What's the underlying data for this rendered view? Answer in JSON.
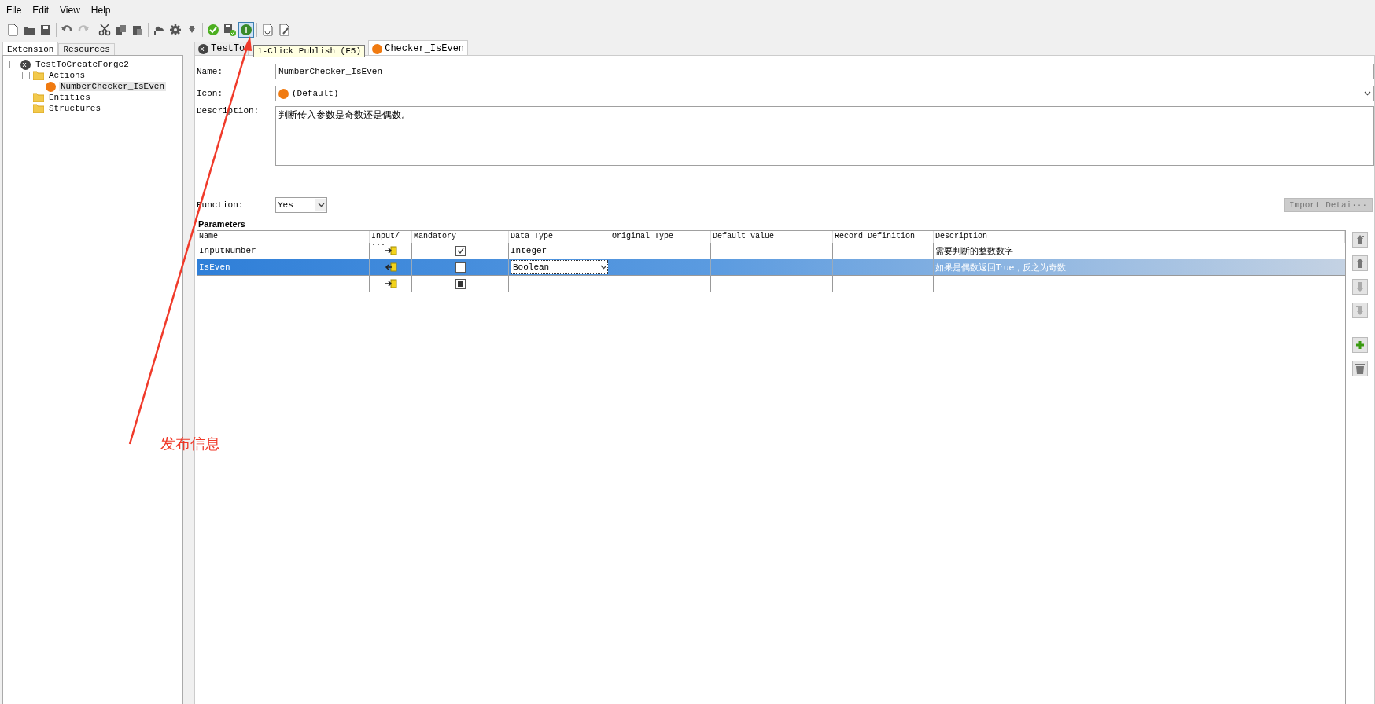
{
  "menu": [
    {
      "label": "File"
    },
    {
      "label": "Edit"
    },
    {
      "label": "View"
    },
    {
      "label": "Help"
    }
  ],
  "toolbar": [
    {
      "kind": "new",
      "highlighted": false
    },
    {
      "kind": "open",
      "highlighted": false
    },
    {
      "kind": "save",
      "highlighted": false
    },
    {
      "kind": "sep"
    },
    {
      "kind": "undo",
      "highlighted": false
    },
    {
      "kind": "redo",
      "highlighted": false
    },
    {
      "kind": "sep"
    },
    {
      "kind": "cut",
      "highlighted": false
    },
    {
      "kind": "copy",
      "highlighted": false
    },
    {
      "kind": "paste",
      "highlighted": false
    },
    {
      "kind": "sep"
    },
    {
      "kind": "deploy",
      "highlighted": false
    },
    {
      "kind": "settings",
      "highlighted": false
    },
    {
      "kind": "download",
      "highlighted": false
    },
    {
      "kind": "sep"
    },
    {
      "kind": "validate",
      "highlighted": false
    },
    {
      "kind": "save-check",
      "highlighted": false
    },
    {
      "kind": "publish",
      "highlighted": true
    },
    {
      "kind": "sep"
    },
    {
      "kind": "code-refresh",
      "highlighted": false
    },
    {
      "kind": "code-edit",
      "highlighted": false
    }
  ],
  "tooltip": "1-Click Publish (F5)",
  "side_tabs": [
    {
      "label": "Extension",
      "selected": true
    },
    {
      "label": "Resources",
      "selected": false
    }
  ],
  "tree": [
    {
      "label": "TestToCreateForge2",
      "kind": "project",
      "expanded": true,
      "selected": false,
      "children": [
        {
          "label": "Actions",
          "kind": "folder",
          "expanded": true,
          "selected": false,
          "children": [
            {
              "label": "NumberChecker_IsEven",
              "kind": "action",
              "selected": true
            }
          ]
        },
        {
          "label": "Entities",
          "kind": "folder",
          "selected": false
        },
        {
          "label": "Structures",
          "kind": "folder",
          "selected": false
        }
      ]
    }
  ],
  "editor_tabs": [
    {
      "label": "TestTo",
      "kind": "project",
      "selected": false
    },
    {
      "label": "Checker_IsEven",
      "kind": "action",
      "selected": true
    }
  ],
  "form": {
    "name_label": "Name:",
    "name": "NumberChecker_IsEven",
    "icon_label": "Icon:",
    "icon": "(Default)",
    "description_label": "Description:",
    "description": "判断传入参数是奇数还是偶数。",
    "function_label": "Function:",
    "function": "Yes",
    "import_button": {
      "label": "Import Detai···",
      "disabled": true
    }
  },
  "parameters": {
    "title": "Parameters",
    "columns": [
      "Name",
      "Input/···",
      "Mandatory",
      "Data Type",
      "Original Type",
      "Default Value",
      "Record Definition",
      "Description"
    ],
    "rows": [
      {
        "kind": "param",
        "name": "InputNumber",
        "output": false,
        "mandatory": true,
        "data_type": "Integer",
        "editing": false,
        "description": "需要判断的整数数字",
        "selected": false
      },
      {
        "kind": "param",
        "name": "IsEven",
        "output": true,
        "mandatory": false,
        "data_type": "Boolean",
        "editing": true,
        "description": "如果是偶数返回True，反之为奇数",
        "selected": true
      },
      {
        "kind": "new",
        "output": false,
        "editing": false,
        "selected": false
      }
    ],
    "buttons": [
      {
        "kind": "top",
        "disabled": false
      },
      {
        "kind": "up",
        "disabled": false
      },
      {
        "kind": "down",
        "disabled": true
      },
      {
        "kind": "bottom",
        "disabled": true
      },
      {
        "kind": "add",
        "disabled": false
      },
      {
        "kind": "delete",
        "disabled": false
      }
    ]
  },
  "annotation": {
    "text": "发布信息"
  }
}
